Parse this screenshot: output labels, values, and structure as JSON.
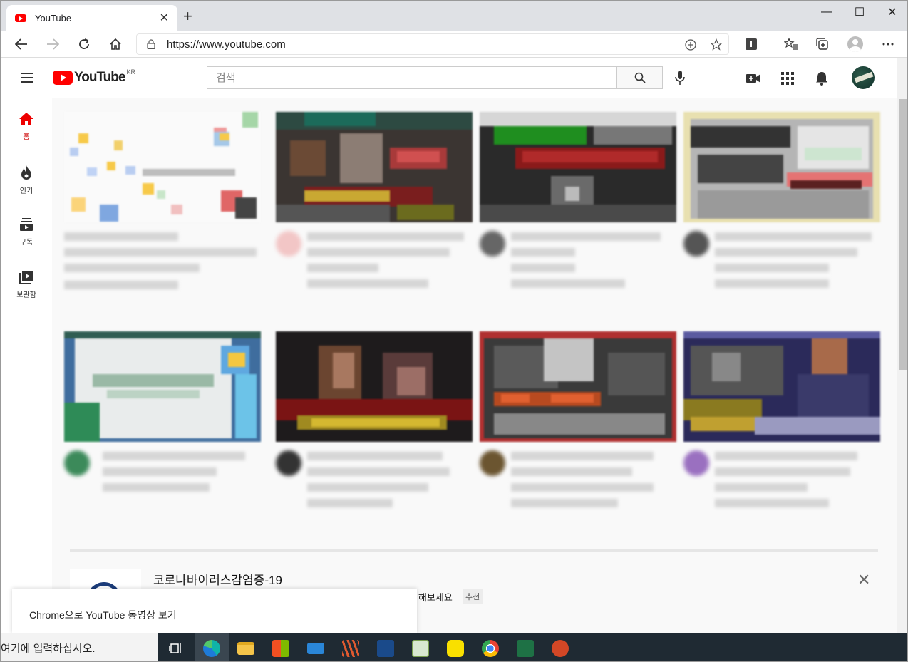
{
  "browser": {
    "tab_title": "YouTube",
    "tab_close": "✕",
    "new_tab": "+",
    "url": "https://www.youtube.com",
    "window_min": "—",
    "window_max": "☐",
    "window_close": "✕"
  },
  "header": {
    "logo_text": "YouTube",
    "logo_region": "KR",
    "search_placeholder": "검색"
  },
  "sidebar": {
    "items": [
      {
        "label": "홈",
        "icon": "home-icon"
      },
      {
        "label": "인기",
        "icon": "fire-icon"
      },
      {
        "label": "구독",
        "icon": "subscriptions-icon"
      },
      {
        "label": "보관함",
        "icon": "library-icon"
      }
    ]
  },
  "colors": {
    "brand_red": "#ff0000",
    "active_red": "#cc0000",
    "taskbar": "#1f2a33"
  },
  "covid_panel": {
    "title": "코로나바이러스감염증-19",
    "subtitle": "해보세요",
    "badge": "추천",
    "close": "✕"
  },
  "toast": {
    "text": "Chrome으로 YouTube 동영상 보기"
  },
  "taskbar": {
    "search_text": "여기에 입력하십시오."
  }
}
